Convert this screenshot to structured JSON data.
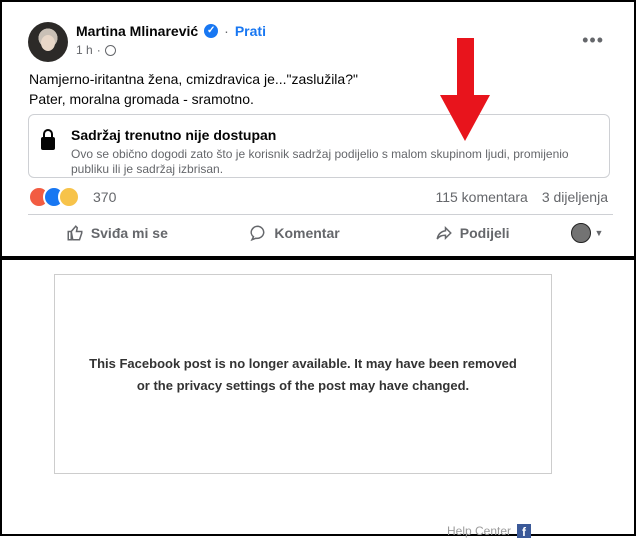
{
  "post": {
    "author": "Martina Mlinarević",
    "follow": "Prati",
    "time": "1 h",
    "dot": "·",
    "text_line1": "Namjerno-iritantna žena, cmizdravica je...\"zaslužila?\"",
    "text_line2": "Pater, moralna gromada - sramotno.",
    "unavailable_title": "Sadržaj trenutno nije dostupan",
    "unavailable_desc": "Ovo se obično dogodi zato što je korisnik sadržaj podijelio s malom skupinom ljudi, promijenio publiku ili je sadržaj izbrisan.",
    "reaction_count": "370",
    "comments": "115 komentara",
    "shares": "3 dijeljenja",
    "actions": {
      "like": "Sviđa mi se",
      "comment": "Komentar",
      "share": "Podijeli"
    }
  },
  "embed": {
    "message": "This Facebook post is no longer available. It may have been removed or the privacy settings of the post may have changed.",
    "help": "Help Center",
    "fb_letter": "f"
  },
  "colors": {
    "facebook_blue": "#1877f2",
    "arrow_red": "#e8141c",
    "muted": "#65676b"
  }
}
